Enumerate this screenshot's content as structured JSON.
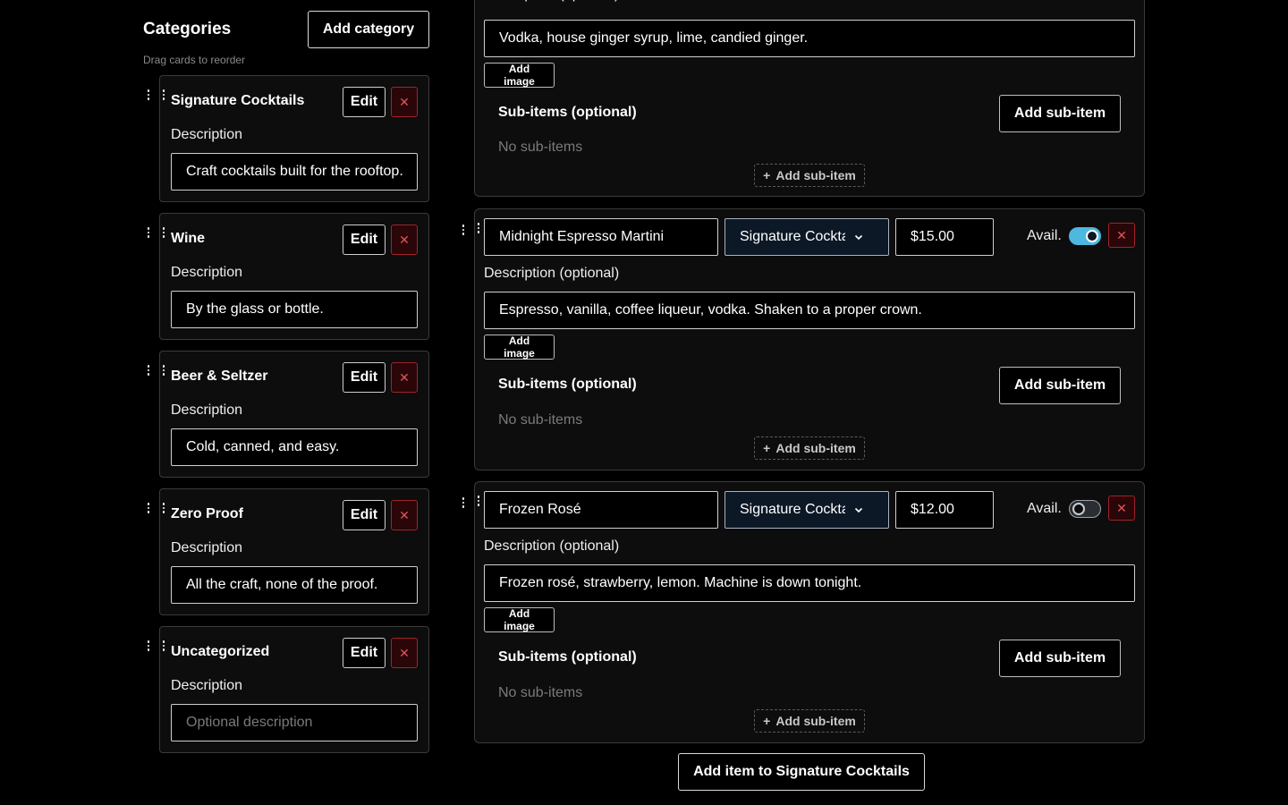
{
  "categories": {
    "title": "Categories",
    "add_label": "Add category",
    "hint": "Drag cards to reorder",
    "desc_label": "Description",
    "edit_label": "Edit",
    "delete_glyph": "✕",
    "items": [
      {
        "name": "Signature Cocktails",
        "description": "Craft cocktails built for the rooftop.",
        "placeholder": ""
      },
      {
        "name": "Wine",
        "description": "By the glass or bottle.",
        "placeholder": ""
      },
      {
        "name": "Beer & Seltzer",
        "description": "Cold, canned, and easy.",
        "placeholder": ""
      },
      {
        "name": "Zero Proof",
        "description": "All the craft, none of the proof.",
        "placeholder": ""
      },
      {
        "name": "Uncategorized",
        "description": "",
        "placeholder": "Optional description"
      }
    ]
  },
  "items_panel": {
    "desc_label": "Description (optional)",
    "add_image_label": "Add image",
    "sub_items_title": "Sub-items (optional)",
    "add_sub_item_label": "Add sub-item",
    "no_sub_items": "No sub-items",
    "add_sub_item_dashed": "Add sub-item",
    "plus_glyph": "+",
    "avail_label": "Avail.",
    "delete_glyph": "✕",
    "items": [
      {
        "description": "Vodka, house ginger syrup, lime, candied ginger."
      },
      {
        "name": "Midnight Espresso Martini",
        "category": "Signature Cocktails",
        "price": "$15.00",
        "available": true,
        "description": "Espresso, vanilla, coffee liqueur, vodka. Shaken to a proper crown."
      },
      {
        "name": "Frozen Rosé",
        "category": "Signature Cocktails",
        "price": "$12.00",
        "available": false,
        "description": "Frozen rosé, strawberry, lemon. Machine is down tonight."
      }
    ],
    "add_item_label": "Add item to Signature Cocktails"
  },
  "colors": {
    "toggle_on": "#4db8e0",
    "danger": "#a0232c",
    "select_bg": "#0d1826"
  }
}
